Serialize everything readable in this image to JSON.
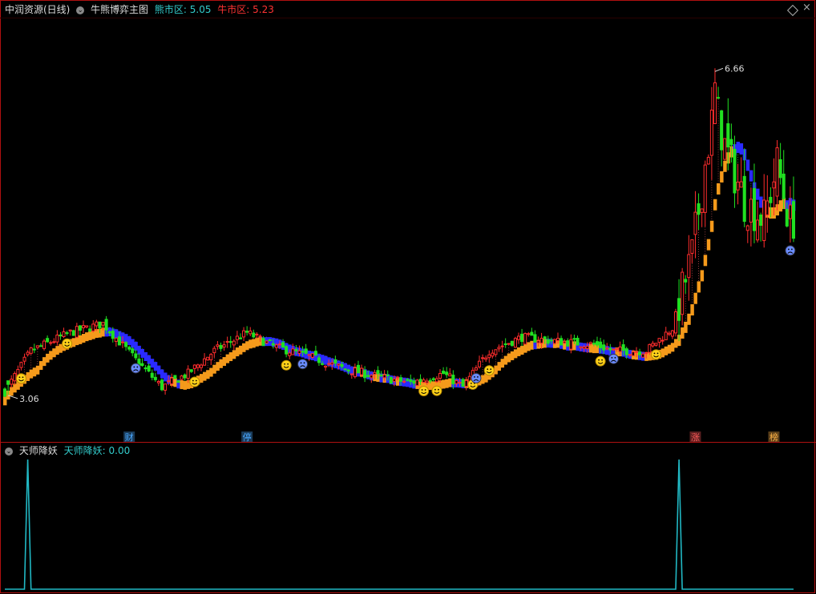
{
  "header": {
    "stock_name": "中润资源(日线)",
    "indicator_name": "牛熊博弈主图",
    "bear_label": "熊市区:",
    "bear_value": "5.05",
    "bull_label": "牛市区:",
    "bull_value": "5.23"
  },
  "sub_header": {
    "indicator_name": "天师降妖",
    "series_label": "天师降妖:",
    "series_value": "0.00"
  },
  "markers": [
    {
      "label": "财",
      "color": "#4aa8ff",
      "bar": 38
    },
    {
      "label": "停",
      "color": "#4aa8ff",
      "bar": 74
    },
    {
      "label": "涨",
      "color": "#ff5a5a",
      "bar": 211
    },
    {
      "label": "榜",
      "color": "#ffb347",
      "bar": 235
    }
  ],
  "colors": {
    "up": "#ff2d2d",
    "down": "#21e021",
    "bull_band": "#f59a1b",
    "bear_band": "#2a2aff",
    "sub_line": "#21b8c4",
    "frame": "#b01010",
    "cyan_text": "#33cccc",
    "red_text": "#ff3333"
  },
  "icons": {
    "settings": "diamond-icon",
    "close": "close-icon",
    "smile": "smile-face-icon",
    "frown": "frown-face-icon"
  },
  "chart_data": [
    {
      "type": "candlestick",
      "title": "牛熊博弈主图",
      "ylim": [
        2.6,
        7.2
      ],
      "high_label": "6.66",
      "low_label": "3.06",
      "high": 6.66,
      "low": 3.06,
      "series": [
        {
          "name": "熊市区",
          "last": 5.05
        },
        {
          "name": "牛市区",
          "last": 5.23
        }
      ]
    },
    {
      "type": "line",
      "title": "天师降妖",
      "series": [
        {
          "name": "天师降妖",
          "last": 0.0
        }
      ],
      "spikes": [
        {
          "bar": 7,
          "value": 1
        },
        {
          "bar": 206,
          "value": 1
        }
      ],
      "ylim": [
        0,
        1
      ]
    }
  ]
}
